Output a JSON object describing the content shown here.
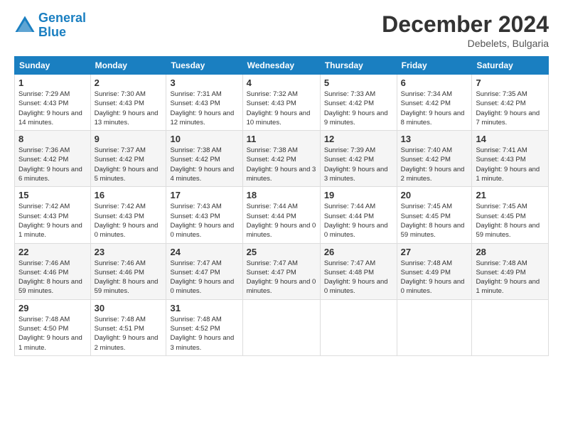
{
  "header": {
    "logo_line1": "General",
    "logo_line2": "Blue",
    "month_title": "December 2024",
    "location": "Debelets, Bulgaria"
  },
  "weekdays": [
    "Sunday",
    "Monday",
    "Tuesday",
    "Wednesday",
    "Thursday",
    "Friday",
    "Saturday"
  ],
  "weeks": [
    [
      {
        "day": "1",
        "info": "Sunrise: 7:29 AM\nSunset: 4:43 PM\nDaylight: 9 hours and 14 minutes."
      },
      {
        "day": "2",
        "info": "Sunrise: 7:30 AM\nSunset: 4:43 PM\nDaylight: 9 hours and 13 minutes."
      },
      {
        "day": "3",
        "info": "Sunrise: 7:31 AM\nSunset: 4:43 PM\nDaylight: 9 hours and 12 minutes."
      },
      {
        "day": "4",
        "info": "Sunrise: 7:32 AM\nSunset: 4:43 PM\nDaylight: 9 hours and 10 minutes."
      },
      {
        "day": "5",
        "info": "Sunrise: 7:33 AM\nSunset: 4:42 PM\nDaylight: 9 hours and 9 minutes."
      },
      {
        "day": "6",
        "info": "Sunrise: 7:34 AM\nSunset: 4:42 PM\nDaylight: 9 hours and 8 minutes."
      },
      {
        "day": "7",
        "info": "Sunrise: 7:35 AM\nSunset: 4:42 PM\nDaylight: 9 hours and 7 minutes."
      }
    ],
    [
      {
        "day": "8",
        "info": "Sunrise: 7:36 AM\nSunset: 4:42 PM\nDaylight: 9 hours and 6 minutes."
      },
      {
        "day": "9",
        "info": "Sunrise: 7:37 AM\nSunset: 4:42 PM\nDaylight: 9 hours and 5 minutes."
      },
      {
        "day": "10",
        "info": "Sunrise: 7:38 AM\nSunset: 4:42 PM\nDaylight: 9 hours and 4 minutes."
      },
      {
        "day": "11",
        "info": "Sunrise: 7:38 AM\nSunset: 4:42 PM\nDaylight: 9 hours and 3 minutes."
      },
      {
        "day": "12",
        "info": "Sunrise: 7:39 AM\nSunset: 4:42 PM\nDaylight: 9 hours and 3 minutes."
      },
      {
        "day": "13",
        "info": "Sunrise: 7:40 AM\nSunset: 4:42 PM\nDaylight: 9 hours and 2 minutes."
      },
      {
        "day": "14",
        "info": "Sunrise: 7:41 AM\nSunset: 4:43 PM\nDaylight: 9 hours and 1 minute."
      }
    ],
    [
      {
        "day": "15",
        "info": "Sunrise: 7:42 AM\nSunset: 4:43 PM\nDaylight: 9 hours and 1 minute."
      },
      {
        "day": "16",
        "info": "Sunrise: 7:42 AM\nSunset: 4:43 PM\nDaylight: 9 hours and 0 minutes."
      },
      {
        "day": "17",
        "info": "Sunrise: 7:43 AM\nSunset: 4:43 PM\nDaylight: 9 hours and 0 minutes."
      },
      {
        "day": "18",
        "info": "Sunrise: 7:44 AM\nSunset: 4:44 PM\nDaylight: 9 hours and 0 minutes."
      },
      {
        "day": "19",
        "info": "Sunrise: 7:44 AM\nSunset: 4:44 PM\nDaylight: 9 hours and 0 minutes."
      },
      {
        "day": "20",
        "info": "Sunrise: 7:45 AM\nSunset: 4:45 PM\nDaylight: 8 hours and 59 minutes."
      },
      {
        "day": "21",
        "info": "Sunrise: 7:45 AM\nSunset: 4:45 PM\nDaylight: 8 hours and 59 minutes."
      }
    ],
    [
      {
        "day": "22",
        "info": "Sunrise: 7:46 AM\nSunset: 4:46 PM\nDaylight: 8 hours and 59 minutes."
      },
      {
        "day": "23",
        "info": "Sunrise: 7:46 AM\nSunset: 4:46 PM\nDaylight: 8 hours and 59 minutes."
      },
      {
        "day": "24",
        "info": "Sunrise: 7:47 AM\nSunset: 4:47 PM\nDaylight: 9 hours and 0 minutes."
      },
      {
        "day": "25",
        "info": "Sunrise: 7:47 AM\nSunset: 4:47 PM\nDaylight: 9 hours and 0 minutes."
      },
      {
        "day": "26",
        "info": "Sunrise: 7:47 AM\nSunset: 4:48 PM\nDaylight: 9 hours and 0 minutes."
      },
      {
        "day": "27",
        "info": "Sunrise: 7:48 AM\nSunset: 4:49 PM\nDaylight: 9 hours and 0 minutes."
      },
      {
        "day": "28",
        "info": "Sunrise: 7:48 AM\nSunset: 4:49 PM\nDaylight: 9 hours and 1 minute."
      }
    ],
    [
      {
        "day": "29",
        "info": "Sunrise: 7:48 AM\nSunset: 4:50 PM\nDaylight: 9 hours and 1 minute."
      },
      {
        "day": "30",
        "info": "Sunrise: 7:48 AM\nSunset: 4:51 PM\nDaylight: 9 hours and 2 minutes."
      },
      {
        "day": "31",
        "info": "Sunrise: 7:48 AM\nSunset: 4:52 PM\nDaylight: 9 hours and 3 minutes."
      },
      null,
      null,
      null,
      null
    ]
  ]
}
